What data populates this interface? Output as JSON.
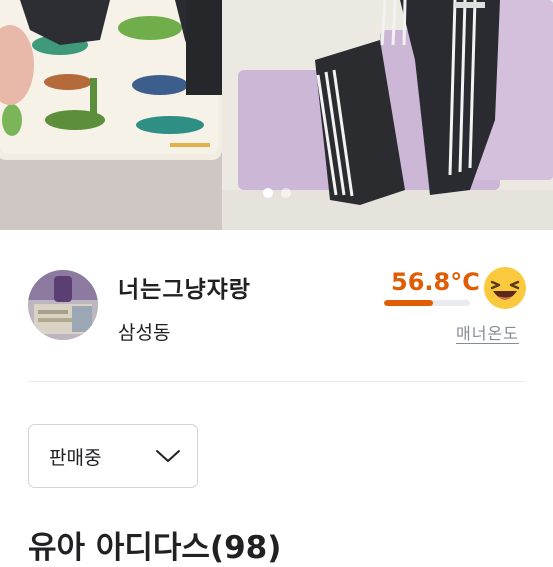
{
  "carousel": {
    "image_description_icon": "product-photo",
    "page_count": 2,
    "active_index": 0
  },
  "seller": {
    "nickname": "너는그냥쟈랑",
    "location": "삼성동",
    "manner_temperature": "56.8°C",
    "manner_level": 0.568,
    "manner_label": "매너온도",
    "emoji_icon": "laughing-face-icon",
    "accent_color": "#de5d06"
  },
  "status": {
    "selected": "판매중",
    "icon": "chevron-down-icon"
  },
  "product": {
    "title": "유아 아디다스(98)"
  }
}
